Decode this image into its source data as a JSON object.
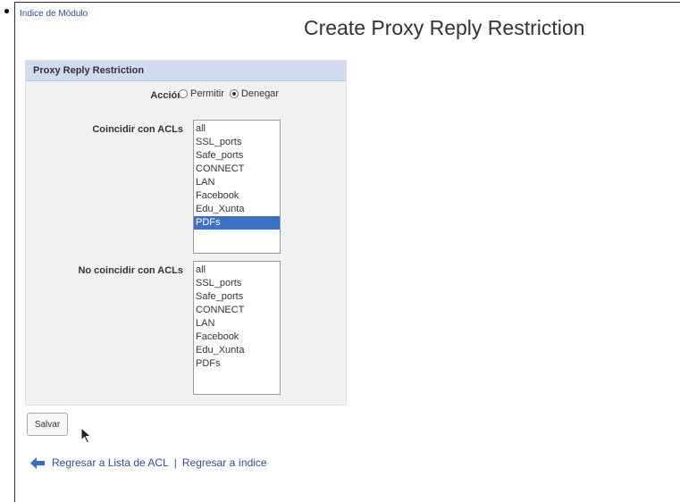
{
  "header": {
    "module_index_link": "Indice de Módulo",
    "page_title": "Create Proxy Reply Restriction"
  },
  "form": {
    "panel_title": "Proxy Reply Restriction",
    "action_label": "Acción",
    "action_options": [
      {
        "label": "Permitir",
        "checked": false
      },
      {
        "label": "Denegar",
        "checked": true
      }
    ],
    "match_acls_label": "Coincidir con ACLs",
    "match_acls_options": [
      "all",
      "SSL_ports",
      "Safe_ports",
      "CONNECT",
      "LAN",
      "Facebook",
      "Edu_Xunta",
      "PDFs"
    ],
    "match_acls_selected": "PDFs",
    "no_match_acls_label": "No coincidir con ACLs",
    "no_match_acls_options": [
      "all",
      "SSL_ports",
      "Safe_ports",
      "CONNECT",
      "LAN",
      "Facebook",
      "Edu_Xunta",
      "PDFs"
    ],
    "no_match_acls_selected": "",
    "save_label": "Salvar"
  },
  "footer": {
    "back_to_acl_list": "Regresar a Lista de ACL",
    "separator": "|",
    "back_to_index": "Regresar a índice"
  },
  "colors": {
    "panel_header": "#cfdcef",
    "selection": "#3b72c7",
    "link": "#2a4d9a",
    "back_arrow": "#3b6cc4"
  },
  "icons": {
    "bullet": "bullet-icon",
    "back": "back-arrow-icon",
    "cursor": "mouse-pointer-icon"
  }
}
